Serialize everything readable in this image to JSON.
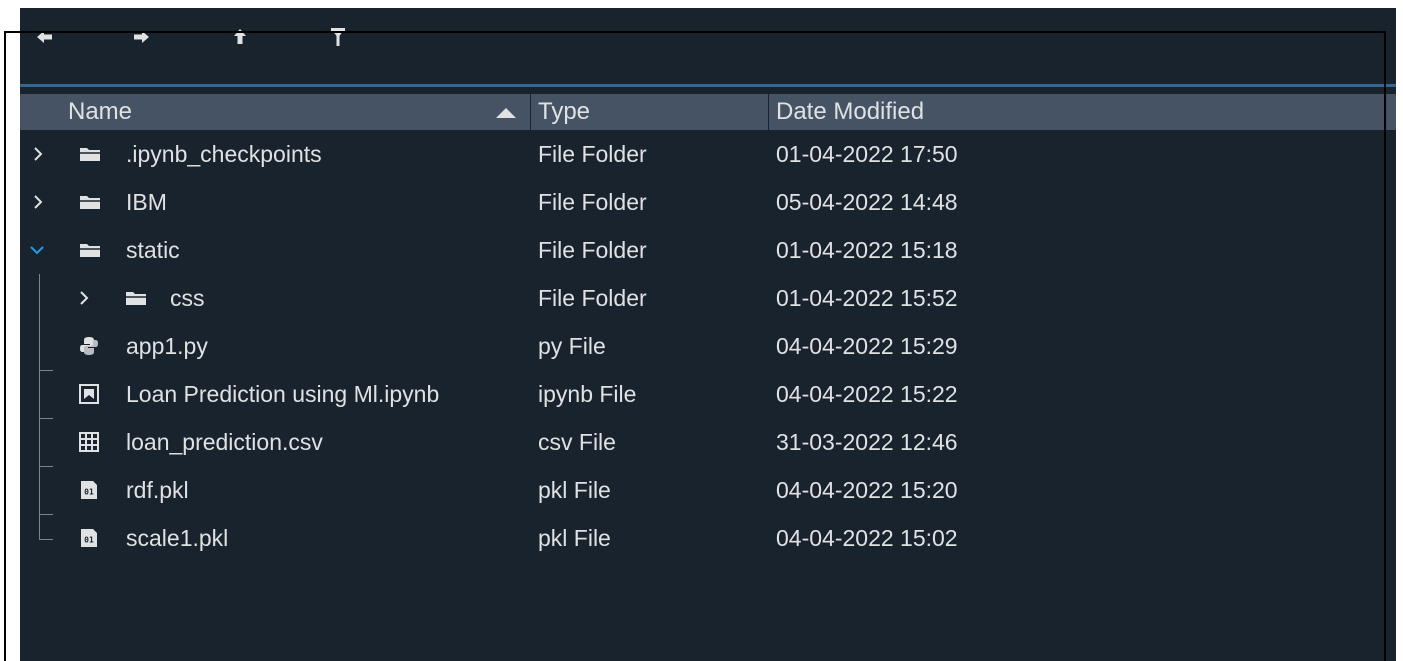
{
  "toolbar": {
    "icons": [
      "back-arrow-icon",
      "forward-arrow-icon",
      "up-arrow-icon",
      "filter-icon"
    ]
  },
  "columns": {
    "name": "Name",
    "type": "Type",
    "date": "Date Modified",
    "sort_indicator": "ascending"
  },
  "rows": [
    {
      "name": ".ipynb_checkpoints",
      "type": "File Folder",
      "date": "01-04-2022 17:50",
      "icon": "folder-icon",
      "expander": "collapsed"
    },
    {
      "name": "IBM",
      "type": "File Folder",
      "date": "05-04-2022 14:48",
      "icon": "folder-icon",
      "expander": "collapsed"
    },
    {
      "name": "static",
      "type": "File Folder",
      "date": "01-04-2022 15:18",
      "icon": "folder-icon",
      "expander": "expanded"
    },
    {
      "name": "css",
      "type": "File Folder",
      "date": "01-04-2022 15:52",
      "icon": "folder-icon",
      "expander": "collapsed"
    },
    {
      "name": "app1.py",
      "type": "py File",
      "date": "04-04-2022 15:29",
      "icon": "python-file-icon"
    },
    {
      "name": "Loan Prediction using Ml.ipynb",
      "type": "ipynb File",
      "date": "04-04-2022 15:22",
      "icon": "notebook-file-icon"
    },
    {
      "name": "loan_prediction.csv",
      "type": "csv File",
      "date": "31-03-2022 12:46",
      "icon": "csv-file-icon"
    },
    {
      "name": "rdf.pkl",
      "type": "pkl File",
      "date": "04-04-2022 15:20",
      "icon": "binary-file-icon"
    },
    {
      "name": "scale1.pkl",
      "type": "pkl File",
      "date": "04-04-2022 15:02",
      "icon": "binary-file-icon"
    }
  ],
  "colors": {
    "background": "#19232d",
    "header": "#455364",
    "text": "#e0e1e3",
    "accent": "#346792",
    "expand_arrow": "#259ae9"
  }
}
